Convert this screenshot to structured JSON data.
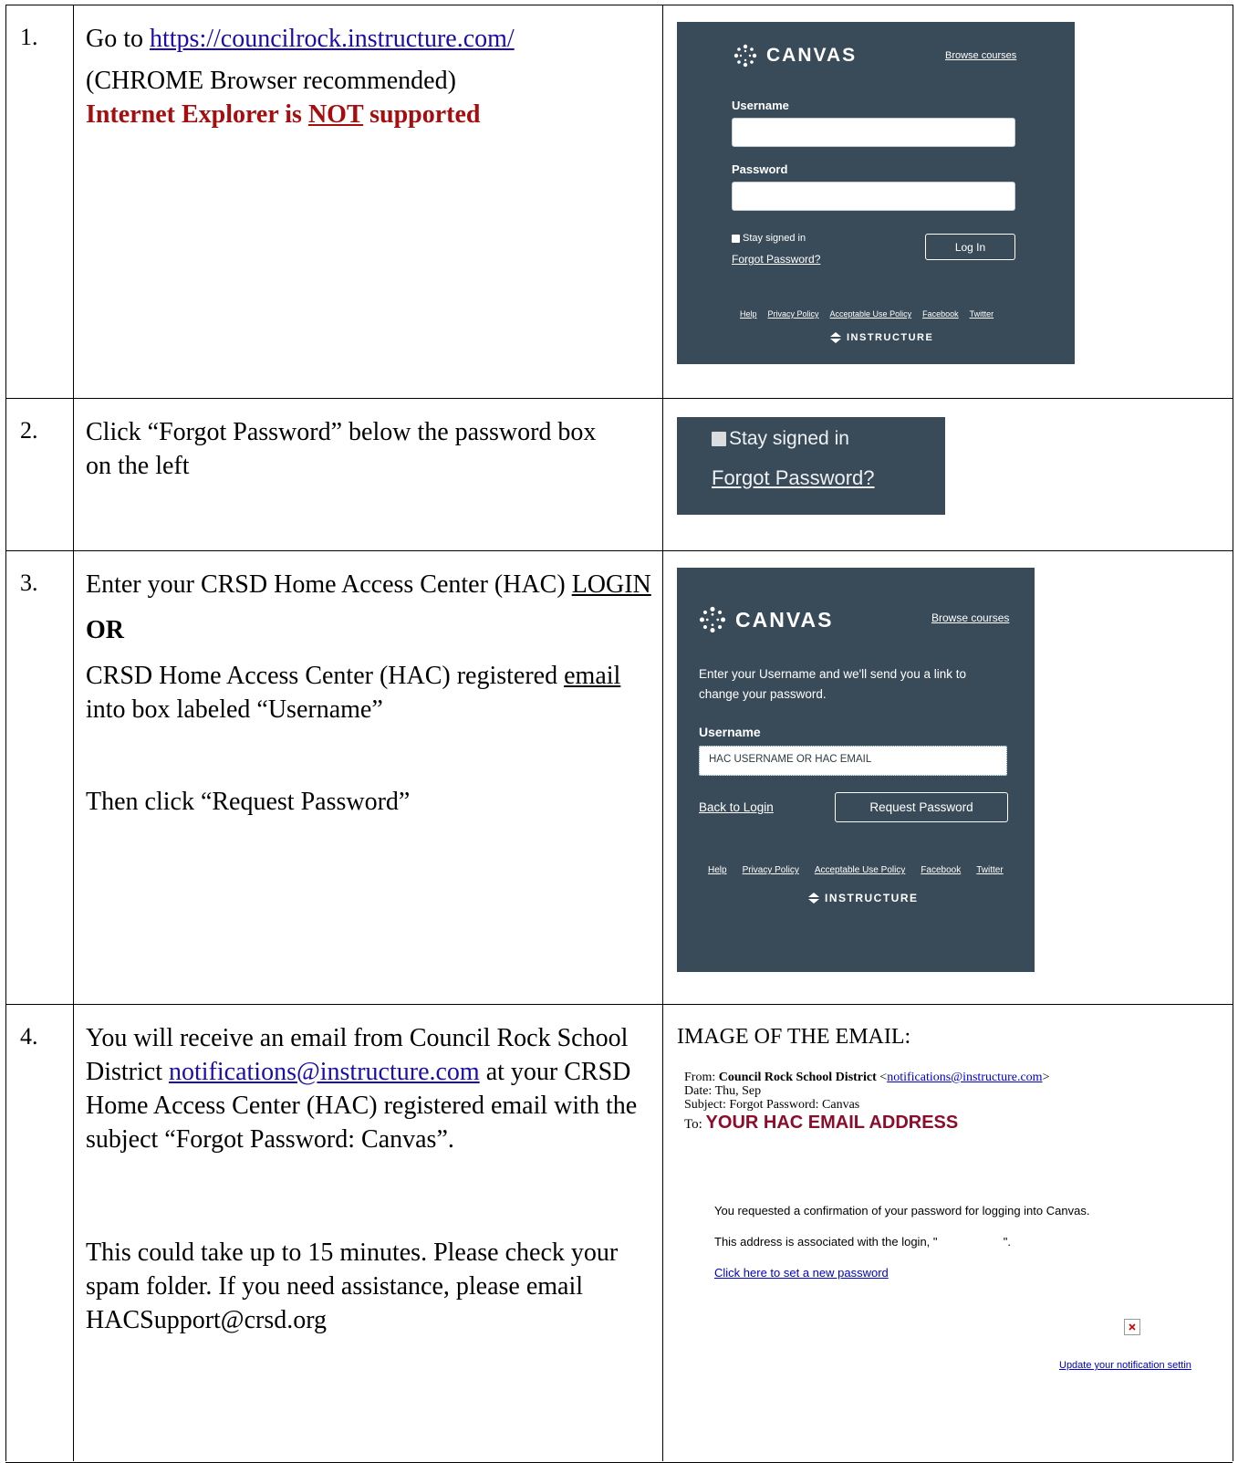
{
  "rows": [
    {
      "number": "1.",
      "text_prefix": "Go to ",
      "link": "https://councilrock.instructure.com/",
      "line2": "(CHROME Browser recommended)",
      "warning_a": "Internet Explorer is ",
      "warning_not": "NOT",
      "warning_b": " supported"
    },
    {
      "number": "2.",
      "text": "Click “Forgot Password” below the password box on the left"
    },
    {
      "number": "3.",
      "line1": "Enter your CRSD Home Access Center (HAC) ",
      "login": "LOGIN",
      "or": "OR",
      "line3a": "CRSD Home Access Center (HAC) registered ",
      "email_word": "email",
      "line3b": " into box labeled “Username”",
      "line4": "Then click “Request Password”"
    },
    {
      "number": "4.",
      "p1a": "You will receive an email from Council Rock School District ",
      "p1_link": "notifications@instructure.com",
      "p1b": " at your CRSD Home Access Center (HAC) registered email with the subject “Forgot Password: Canvas”.",
      "p2": "This could take up to 15 minutes.  Please check your spam folder.  If you need assistance, please email HACSupport@crsd.org"
    }
  ],
  "canvas_login": {
    "brand": "CANVAS",
    "browse": "Browse courses",
    "username_label": "Username",
    "password_label": "Password",
    "stay_signed_in": "Stay signed in",
    "forgot": "Forgot Password?",
    "login_button": "Log In",
    "footer": [
      "Help",
      "Privacy Policy",
      "Acceptable Use Policy",
      "Facebook",
      "Twitter"
    ],
    "instructure": "INSTRUCTURE"
  },
  "canvas_forgot": {
    "brand": "CANVAS",
    "browse": "Browse courses",
    "instructions": "Enter your Username and we'll send you a link to change your password.",
    "username_label": "Username",
    "username_value": "HAC USERNAME OR HAC EMAIL",
    "back": "Back to Login",
    "request_button": "Request Password",
    "footer": [
      "Help",
      "Privacy Policy",
      "Acceptable Use Policy",
      "Facebook",
      "Twitter"
    ],
    "instructure": "INSTRUCTURE"
  },
  "email": {
    "caption": "IMAGE OF THE EMAIL:",
    "from_label": "From: ",
    "from_name": "Council Rock School District",
    "from_addr": "notifications@instructure.com",
    "date": "Date: Thu, Sep",
    "subject": "Subject: Forgot Password: Canvas",
    "to_label": "To: ",
    "to_value": "YOUR HAC EMAIL ADDRESS",
    "body1": "You requested a confirmation of your password for logging into Canvas.",
    "body2": "This address is associated with the login, \"                    \".",
    "link": "Click here to set a new password",
    "footer_link": "Update your notification settin"
  },
  "colors": {
    "canvas_bg": "#394b58",
    "warning_red": "#a50e0e",
    "email_red": "#8b0d2b",
    "link_blue": "#1a0dab"
  }
}
